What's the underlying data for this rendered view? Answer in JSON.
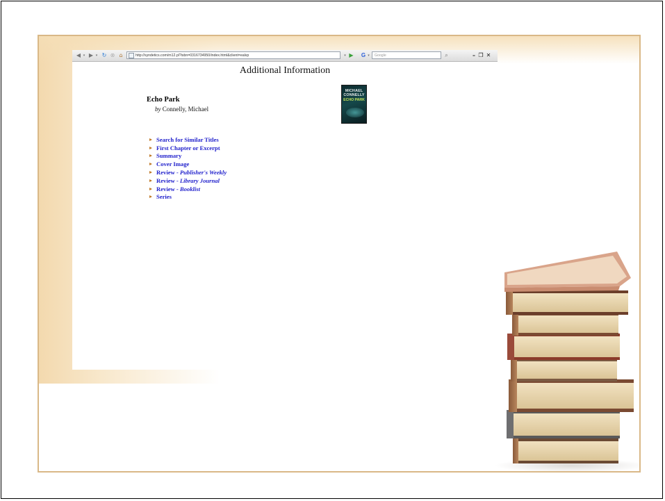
{
  "browser": {
    "url": "http://syndetics.com/m12.pl?isbn=0316734950/index.html&client=ealvp",
    "search_placeholder": "Google"
  },
  "page": {
    "heading": "Additional Information"
  },
  "book": {
    "title": "Echo Park",
    "by_label": "by",
    "author": "Connelly, Michael",
    "cover": {
      "author_text": "MICHAEL CONNELLY",
      "title_text": "ECHO PARK"
    }
  },
  "links": [
    {
      "text": "Search for Similar Titles",
      "emphasis": ""
    },
    {
      "text": "First Chapter or Excerpt",
      "emphasis": ""
    },
    {
      "text": "Summary",
      "emphasis": ""
    },
    {
      "text": "Cover Image",
      "emphasis": ""
    },
    {
      "text": "Review - ",
      "emphasis": "Publisher's Weekly"
    },
    {
      "text": "Review - ",
      "emphasis": "Library Journal"
    },
    {
      "text": "Review - ",
      "emphasis": "Booklist"
    },
    {
      "text": "Series",
      "emphasis": ""
    }
  ],
  "colors": {
    "link": "#2222cc",
    "frame_border": "#d9b887",
    "arrow": "#c07a28"
  }
}
